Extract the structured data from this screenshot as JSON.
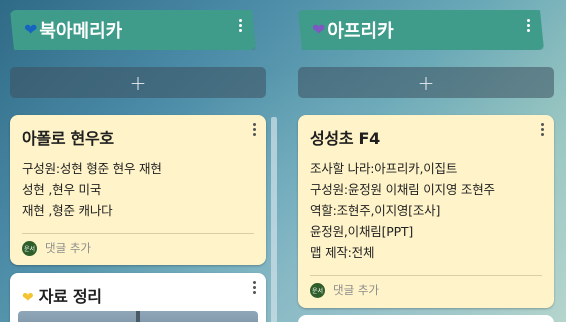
{
  "columns": [
    {
      "title": "북아메리카",
      "heart_color": "#1565c0",
      "heart_icon": "blue-heart-icon",
      "add_label": "+",
      "cards": [
        {
          "title": "아폴로 현우호",
          "lines": [
            "구성원:성현 형준 현우 재현",
            "성현 ,현우 미국",
            "재현 ,형준 캐나다"
          ],
          "avatar_text": "운서",
          "comment_label": "댓글 추가"
        },
        {
          "title": "자료 정리",
          "title_icon": "yellow-heart-icon"
        }
      ]
    },
    {
      "title": "아프리카",
      "heart_color": "#7e57c2",
      "heart_icon": "purple-heart-icon",
      "add_label": "+",
      "cards": [
        {
          "title": "성성초 F4",
          "lines": [
            "조사할 나라:아프리카,이집트",
            "구성원:윤정원 이채림 이지영 조현주",
            "역할:조현주,이지영[조사]",
            "윤정원,이채림[PPT]",
            "맵 제작:전체"
          ],
          "avatar_text": "운서",
          "comment_label": "댓글 추가"
        }
      ]
    }
  ]
}
